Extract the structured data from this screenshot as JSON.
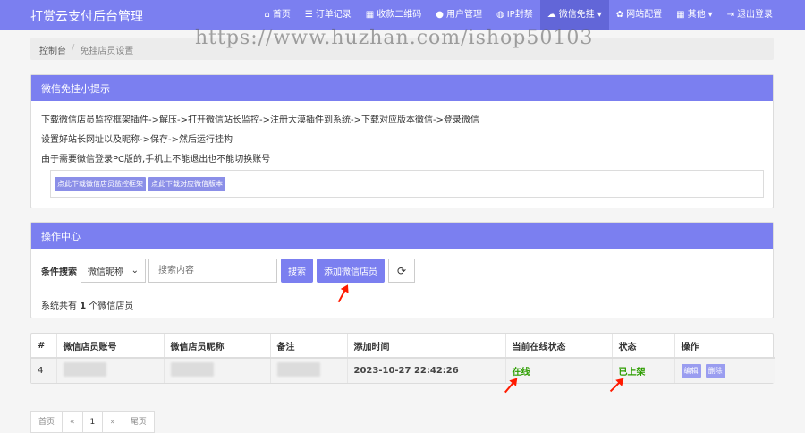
{
  "app": {
    "title": "打赏云支付后台管理"
  },
  "nav": [
    {
      "icon": "home-icon",
      "glyph": "⌂",
      "label": "首页"
    },
    {
      "icon": "list-icon",
      "glyph": "☰",
      "label": "订单记录"
    },
    {
      "icon": "qrcode-icon",
      "glyph": "▦",
      "label": "收款二维码"
    },
    {
      "icon": "user-icon",
      "glyph": "●",
      "label": "用户管理"
    },
    {
      "icon": "globe-icon",
      "glyph": "◍",
      "label": "IP封禁"
    },
    {
      "icon": "wechat-icon",
      "glyph": "☁",
      "label": "微信免挂",
      "suffix": "▾"
    },
    {
      "icon": "gear-icon",
      "glyph": "✿",
      "label": "网站配置"
    },
    {
      "icon": "grid-icon",
      "glyph": "▦",
      "label": "其他",
      "suffix": "▾"
    },
    {
      "icon": "logout-icon",
      "glyph": "⇥",
      "label": "退出登录"
    }
  ],
  "watermark": "https://www.huzhan.com/ishop50103",
  "breadcrumb": {
    "home": "控制台",
    "separator": "/",
    "current": "免挂店员设置"
  },
  "tips_panel": {
    "title": "微信免挂小提示",
    "lines": [
      "下载微信店员监控框架插件->解压->打开微信站长监控->注册大漠插件到系统->下载对应版本微信->登录微信",
      "设置好站长网址以及昵称->保存->然后运行挂构",
      "由于需要微信登录PC版的,手机上不能退出也不能切换账号"
    ],
    "buttons": [
      "点此下载微信店员监控框架",
      "点此下载对应微信版本"
    ]
  },
  "ops_panel": {
    "title": "操作中心",
    "search_label": "条件搜索",
    "select_value": "微信昵称",
    "search_placeholder": "搜索内容",
    "search_button": "搜索",
    "add_button": "添加微信店员",
    "count_prefix": "系统共有",
    "count": "1",
    "count_suffix": "个微信店员"
  },
  "table": {
    "headers": [
      "#",
      "微信店员账号",
      "微信店员昵称",
      "备注",
      "添加时间",
      "当前在线状态",
      "状态",
      "操作"
    ],
    "rows": [
      {
        "id": "4",
        "time": "2023-10-27 22:42:26",
        "online": "在线",
        "status": "已上架",
        "edit": "编辑",
        "delete": "删除"
      }
    ]
  },
  "pagination": [
    "首页",
    "«",
    "1",
    "»",
    "尾页"
  ],
  "colors": {
    "primary": "#7b7ff0",
    "success": "#2d9d00",
    "annotation": "#ff1a00"
  }
}
